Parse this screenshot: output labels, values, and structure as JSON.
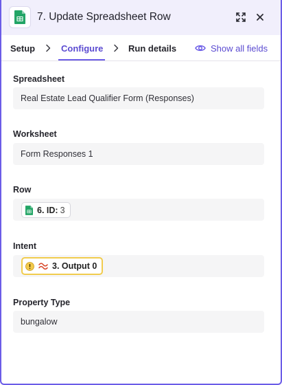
{
  "header": {
    "title": "7. Update Spreadsheet Row",
    "app_icon": "google-sheets-icon",
    "expand_icon": "expand-icon",
    "close_icon": "close-icon"
  },
  "tabs": [
    {
      "label": "Setup",
      "active": false
    },
    {
      "label": "Configure",
      "active": true
    },
    {
      "label": "Run details",
      "active": false
    }
  ],
  "show_all_fields": {
    "label": "Show all fields",
    "icon": "eye-icon"
  },
  "fields": {
    "spreadsheet": {
      "label": "Spreadsheet",
      "value": "Real Estate Lead Qualifier Form (Responses)"
    },
    "worksheet": {
      "label": "Worksheet",
      "value": "Form Responses 1"
    },
    "row": {
      "label": "Row",
      "pill": {
        "step": "6. ID:",
        "value": "3",
        "icon": "google-sheets-icon"
      }
    },
    "intent": {
      "label": "Intent",
      "pill": {
        "step": "3. Output 0",
        "icons": [
          "warning-icon",
          "formatter-icon"
        ]
      }
    },
    "property_type": {
      "label": "Property Type",
      "value": "bungalow"
    }
  },
  "colors": {
    "accent": "#6b5ce7",
    "header_bg": "#f1effc",
    "sheets_green": "#23a566",
    "warning_border": "#f1cc4d"
  }
}
